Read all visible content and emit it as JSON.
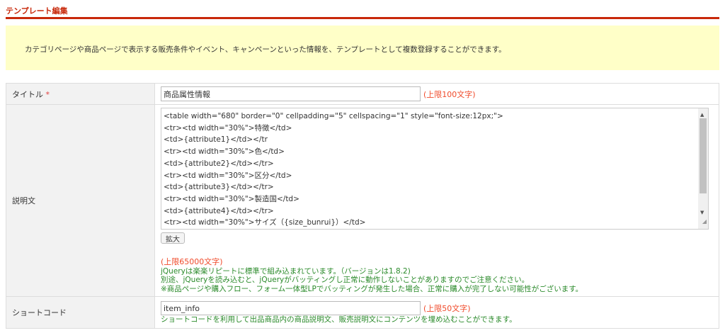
{
  "heading": "テンプレート編集",
  "notice": "カテゴリページや商品ページで表示する販売条件やイベント、キャンペーンといった情報を、テンプレートとして複数登録することができます。",
  "title_row": {
    "label": "タイトル",
    "required": "*",
    "value": "商品属性情報",
    "limit": "(上限100文字)"
  },
  "desc_row": {
    "label": "説明文",
    "code": "<table width=\"680\" border=\"0\" cellpadding=\"5\" cellspacing=\"1\" style=\"font-size:12px;\">\n<tr><td width=\"30%\">特徴</td>\n<td>{attribute1}</td></tr\n<tr><td width=\"30%\">色</td>\n<td>{attribute2}</td></tr>\n<tr><td width=\"30%\">区分</td>\n<td>{attribute3}</td></tr>\n<tr><td width=\"30%\">製造国</td>\n<td>{attribute4}</td></tr>\n<tr><td width=\"30%\">サイズ（{size_bunrui}）</td>",
    "expand": "拡大",
    "limit": "(上限65000文字)",
    "notes": [
      "jQueryは楽楽リピートに標準で組み込まれています。（バージョンは1.8.2)",
      "別途、jQueryを読み込むと、jQueryがバッティングし正常に動作しないことがありますのでご注意ください。",
      "※商品ページや購入フロー、フォーム一体型LPでバッティングが発生した場合、正常に購入が完了しない可能性がございます。"
    ]
  },
  "shortcode_row": {
    "label": "ショートコード",
    "value": "item_info",
    "limit": "(上限50文字)",
    "note": "ショートコードを利用して出品商品内の商品説明文、販売説明文にコンテンツを埋め込むことができます。"
  }
}
